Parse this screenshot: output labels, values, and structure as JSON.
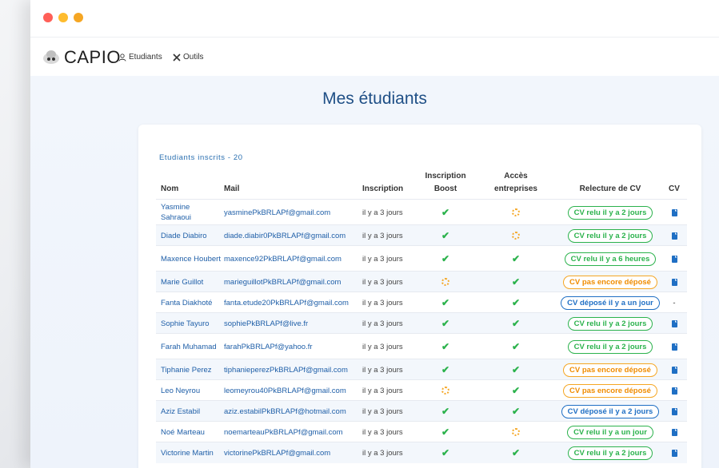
{
  "app": {
    "logo_text": "CAPIO"
  },
  "nav": {
    "etudiants": "Etudiants",
    "outils": "Outils"
  },
  "page": {
    "title": "Mes étudiants"
  },
  "table": {
    "count_label": "Etudiants inscrits - 20",
    "headers": {
      "nom": "Nom",
      "mail": "Mail",
      "inscription": "Inscription",
      "boost_line1": "Inscription",
      "boost_line2": "Boost",
      "acces_line1": "Accès",
      "acces_line2": "entreprises",
      "relecture": "Relecture de CV",
      "cv": "CV"
    },
    "rows": [
      {
        "name": "Yasmine Sahraoui",
        "mail": "yasminePkBRLAPf@gmail.com",
        "inscription": "il y a 3 jours",
        "boost": "done",
        "acces": "pending",
        "relecture": "CV relu il y a 2 jours",
        "relecture_status": "green",
        "cv": "doc"
      },
      {
        "name": "Diade Diabiro",
        "mail": "diade.diabir0PkBRLAPf@gmail.com",
        "inscription": "il y a 3 jours",
        "boost": "done",
        "acces": "pending",
        "relecture": "CV relu il y a 2 jours",
        "relecture_status": "green",
        "cv": "doc"
      },
      {
        "name": "Maxence Houbert",
        "mail": "maxence92PkBRLAPf@gmail.com",
        "inscription": "il y a 3 jours",
        "boost": "done",
        "acces": "done",
        "relecture": "CV relu il y a 6 heures",
        "relecture_status": "green",
        "cv": "doc"
      },
      {
        "name": "Marie Guillot",
        "mail": "marieguillotPkBRLAPf@gmail.com",
        "inscription": "il y a 3 jours",
        "boost": "pending",
        "acces": "done",
        "relecture": "CV pas encore déposé",
        "relecture_status": "orange",
        "cv": "doc"
      },
      {
        "name": "Fanta Diakhoté",
        "mail": "fanta.etude20PkBRLAPf@gmail.com",
        "inscription": "il y a 3 jours",
        "boost": "done",
        "acces": "done",
        "relecture": "CV déposé il y a un jour",
        "relecture_status": "blue",
        "cv": "-"
      },
      {
        "name": "Sophie Tayuro",
        "mail": "sophiePkBRLAPf@live.fr",
        "inscription": "il y a 3 jours",
        "boost": "done",
        "acces": "done",
        "relecture": "CV relu il y a 2 jours",
        "relecture_status": "green",
        "cv": "doc"
      },
      {
        "name": "Farah Muhamad",
        "mail": "farahPkBRLAPf@yahoo.fr",
        "inscription": "il y a 3 jours",
        "boost": "done",
        "acces": "done",
        "relecture": "CV relu il y a 2 jours",
        "relecture_status": "green",
        "cv": "doc"
      },
      {
        "name": "Tiphanie Perez",
        "mail": "tiphanieperezPkBRLAPf@gmail.com",
        "inscription": "il y a 3 jours",
        "boost": "done",
        "acces": "done",
        "relecture": "CV pas encore déposé",
        "relecture_status": "orange",
        "cv": "doc"
      },
      {
        "name": "Leo Neyrou",
        "mail": "leomeyrou40PkBRLAPf@gmail.com",
        "inscription": "il y a 3 jours",
        "boost": "pending",
        "acces": "done",
        "relecture": "CV pas encore déposé",
        "relecture_status": "orange",
        "cv": "doc"
      },
      {
        "name": "Aziz Estabil",
        "mail": "aziz.estabilPkBRLAPf@hotmail.com",
        "inscription": "il y a 3 jours",
        "boost": "done",
        "acces": "done",
        "relecture": "CV déposé il y a 2 jours",
        "relecture_status": "blue",
        "cv": "doc"
      },
      {
        "name": "Noé Marteau",
        "mail": "noemarteauPkBRLAPf@gmail.com",
        "inscription": "il y a 3 jours",
        "boost": "done",
        "acces": "pending",
        "relecture": "CV relu il y a un jour",
        "relecture_status": "green",
        "cv": "doc"
      },
      {
        "name": "Victorine Martin",
        "mail": "victorinePkBRLAPf@gmail.com",
        "inscription": "il y a 3 jours",
        "boost": "done",
        "acces": "done",
        "relecture": "CV relu il y a 2 jours",
        "relecture_status": "green",
        "cv": "doc"
      }
    ]
  }
}
